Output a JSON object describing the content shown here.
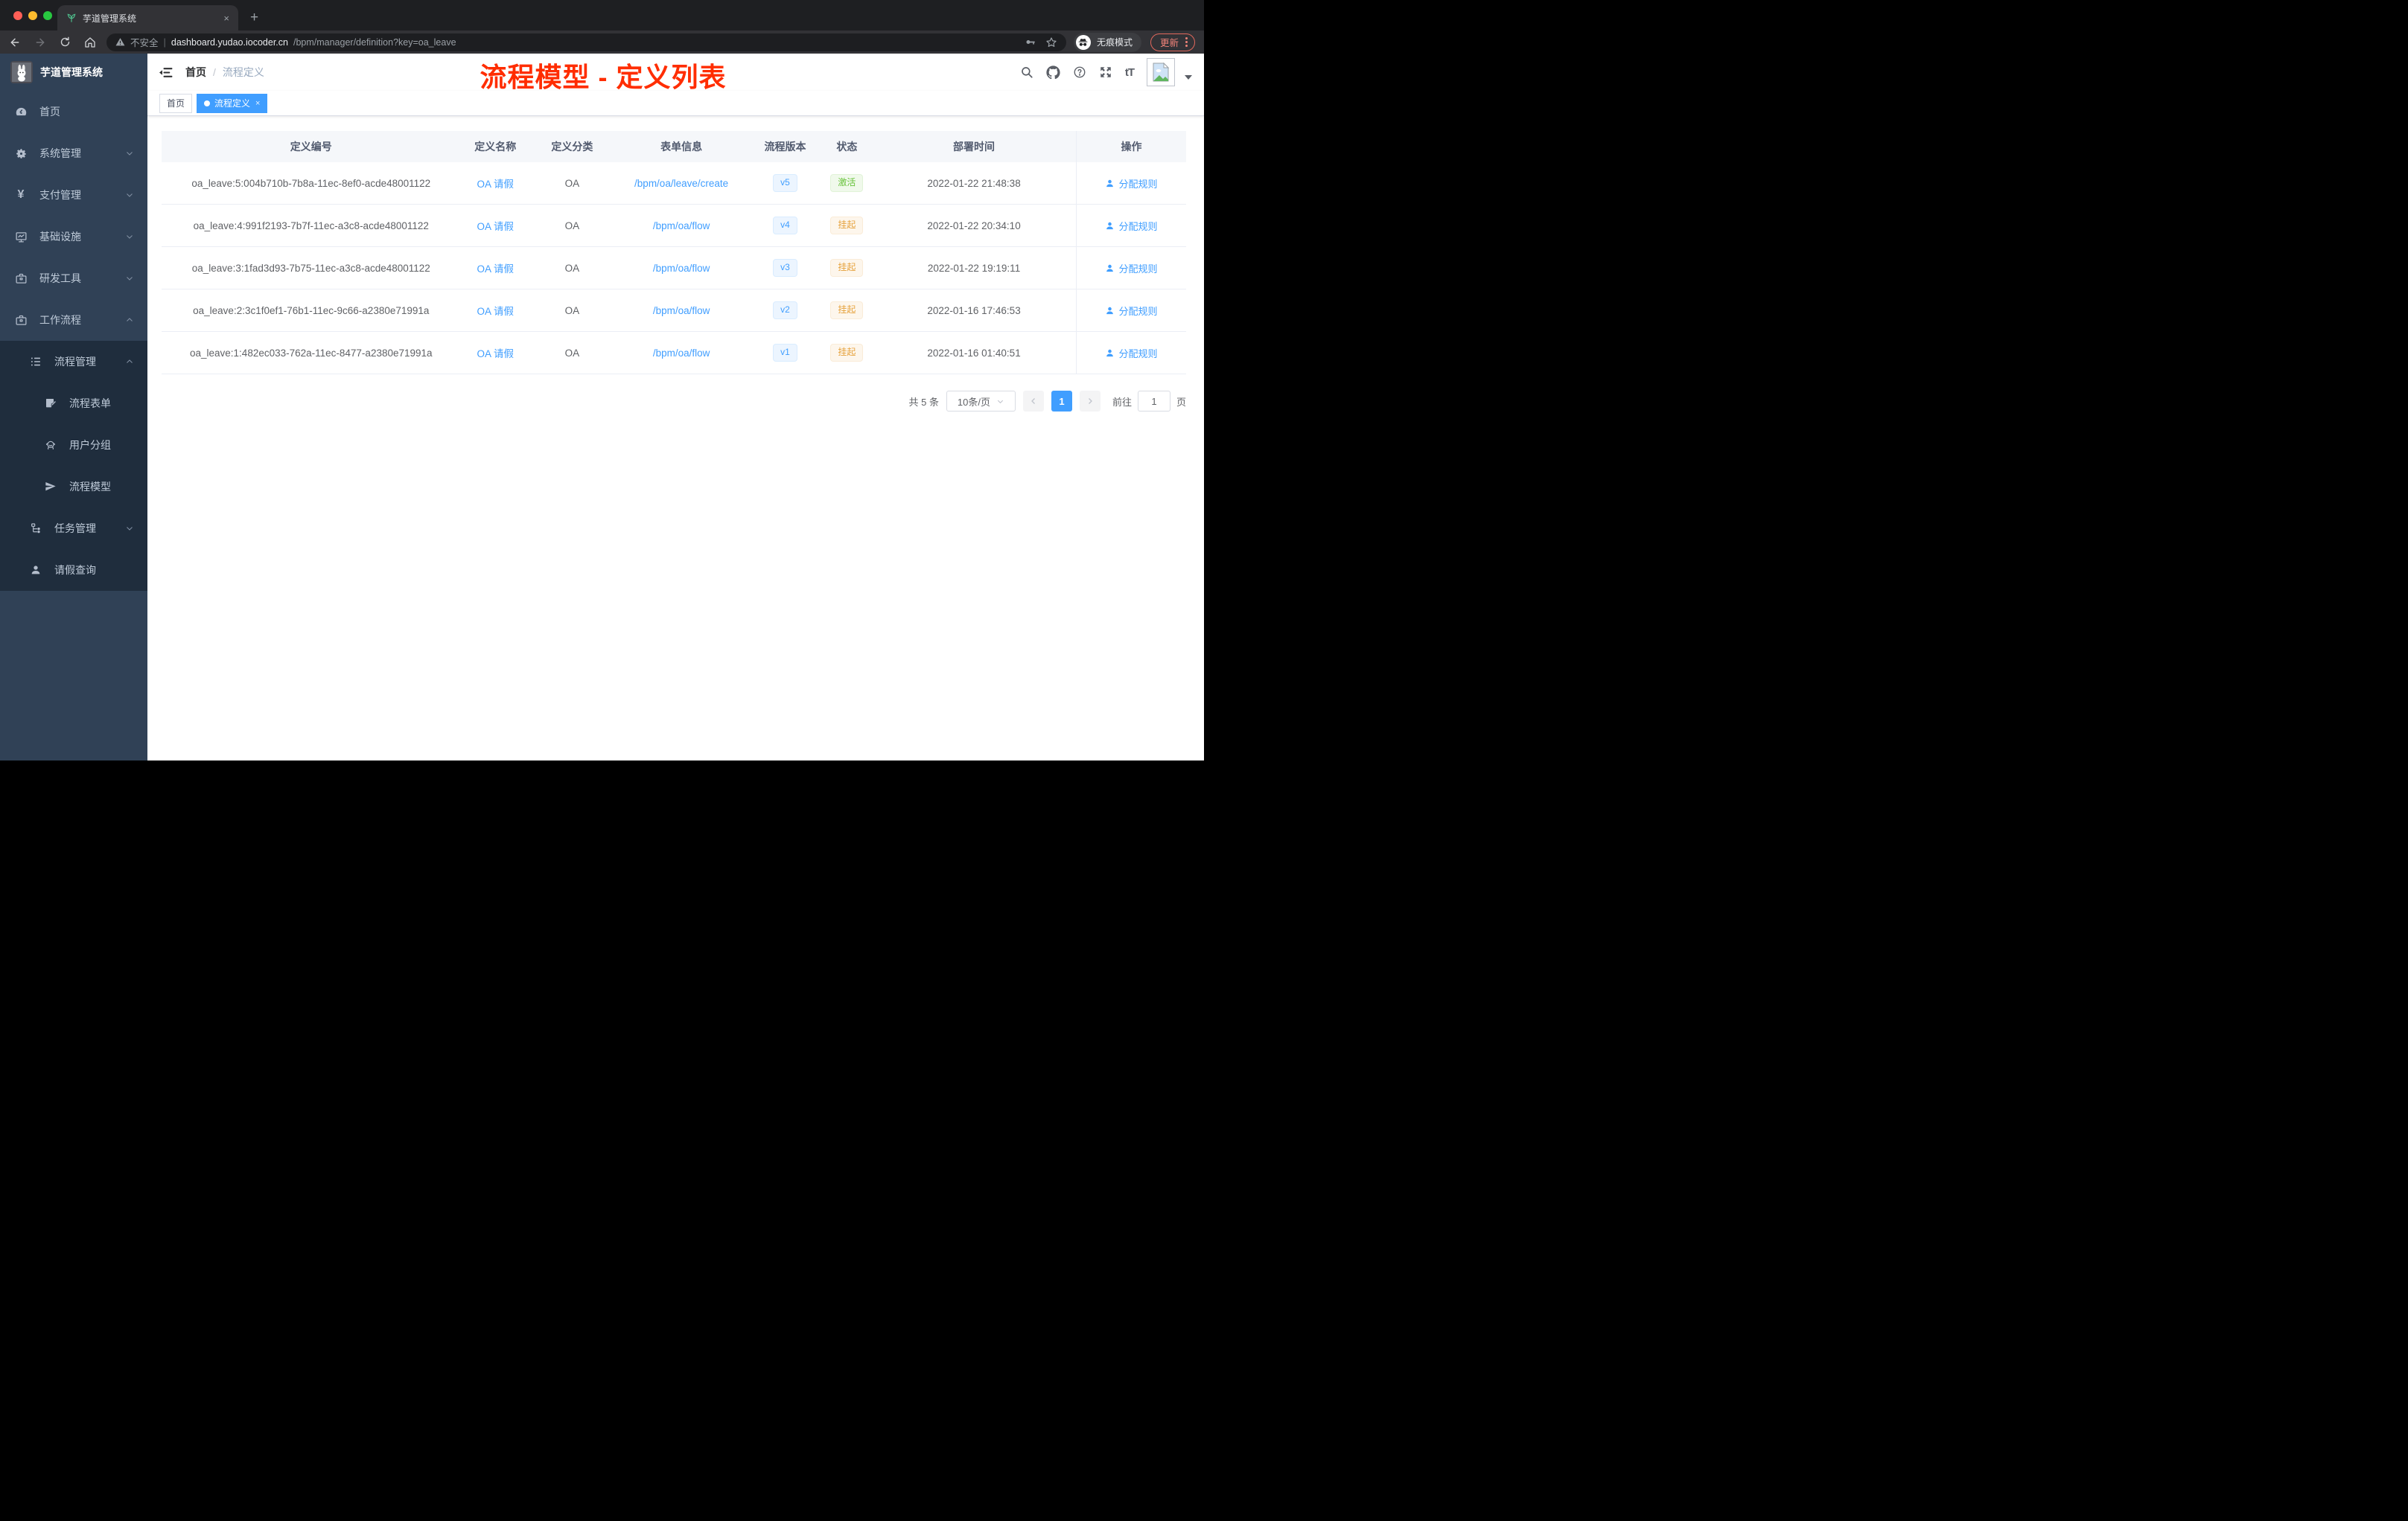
{
  "browser": {
    "tab": {
      "title": "芋道管理系统",
      "close_label": "×",
      "new_tab_label": "+"
    },
    "toolbar": {
      "security_label": "不安全",
      "url_host": "dashboard.yudao.iocoder.cn",
      "url_path": "/bpm/manager/definition?key=oa_leave",
      "separator": "|",
      "incognito_label": "无痕模式",
      "update_label": "更新"
    }
  },
  "sidebar": {
    "logo_title": "芋道管理系统",
    "items": [
      {
        "label": "首页",
        "icon": "dashboard-icon"
      },
      {
        "label": "系统管理",
        "icon": "gear-icon"
      },
      {
        "label": "支付管理",
        "icon": "yen-icon"
      },
      {
        "label": "基础设施",
        "icon": "monitor-icon"
      },
      {
        "label": "研发工具",
        "icon": "toolbox-icon"
      },
      {
        "label": "工作流程",
        "icon": "briefcase-icon"
      }
    ],
    "workflow_children": [
      {
        "label": "流程管理",
        "icon": "list-icon"
      },
      {
        "label": "流程表单",
        "icon": "form-icon"
      },
      {
        "label": "用户分组",
        "icon": "user-group-icon"
      },
      {
        "label": "流程模型",
        "icon": "paper-plane-icon"
      },
      {
        "label": "任务管理",
        "icon": "tree-icon"
      },
      {
        "label": "请假查询",
        "icon": "person-icon"
      }
    ]
  },
  "header": {
    "breadcrumb_home": "首页",
    "breadcrumb_separator": "/",
    "breadcrumb_current": "流程定义",
    "annotation": "流程模型 - 定义列表",
    "annotation_color": "#ff2d00"
  },
  "tags": [
    {
      "label": "首页"
    },
    {
      "label": "流程定义",
      "close_label": "×"
    }
  ],
  "table": {
    "columns": [
      "定义编号",
      "定义名称",
      "定义分类",
      "表单信息",
      "流程版本",
      "状态",
      "部署时间",
      "操作"
    ],
    "rows": [
      {
        "id": "oa_leave:5:004b710b-7b8a-11ec-8ef0-acde48001122",
        "name": "OA 请假",
        "category": "OA",
        "form": "/bpm/oa/leave/create",
        "version": "v5",
        "status": "激活",
        "time": "2022-01-22 21:48:38",
        "action": "分配规则"
      },
      {
        "id": "oa_leave:4:991f2193-7b7f-11ec-a3c8-acde48001122",
        "name": "OA 请假",
        "category": "OA",
        "form": "/bpm/oa/flow",
        "version": "v4",
        "status": "挂起",
        "time": "2022-01-22 20:34:10",
        "action": "分配规则"
      },
      {
        "id": "oa_leave:3:1fad3d93-7b75-11ec-a3c8-acde48001122",
        "name": "OA 请假",
        "category": "OA",
        "form": "/bpm/oa/flow",
        "version": "v3",
        "status": "挂起",
        "time": "2022-01-22 19:19:11",
        "action": "分配规则"
      },
      {
        "id": "oa_leave:2:3c1f0ef1-76b1-11ec-9c66-a2380e71991a",
        "name": "OA 请假",
        "category": "OA",
        "form": "/bpm/oa/flow",
        "version": "v2",
        "status": "挂起",
        "time": "2022-01-16 17:46:53",
        "action": "分配规则"
      },
      {
        "id": "oa_leave:1:482ec033-762a-11ec-8477-a2380e71991a",
        "name": "OA 请假",
        "category": "OA",
        "form": "/bpm/oa/flow",
        "version": "v1",
        "status": "挂起",
        "time": "2022-01-16 01:40:51",
        "action": "分配规则"
      }
    ]
  },
  "pagination": {
    "total": "共 5 条",
    "page_size": "10条/页",
    "current_page": "1",
    "goto_label": "前往",
    "goto_value": "1",
    "page_unit": "页"
  },
  "colors": {
    "accent_blue": "#409eff",
    "annotation_red": "#ff2d00",
    "status_active_green": "#67c23a",
    "status_suspended_orange": "#e6a23c",
    "sidebar_bg": "#304156",
    "submenu_bg": "#1f2d3d"
  }
}
